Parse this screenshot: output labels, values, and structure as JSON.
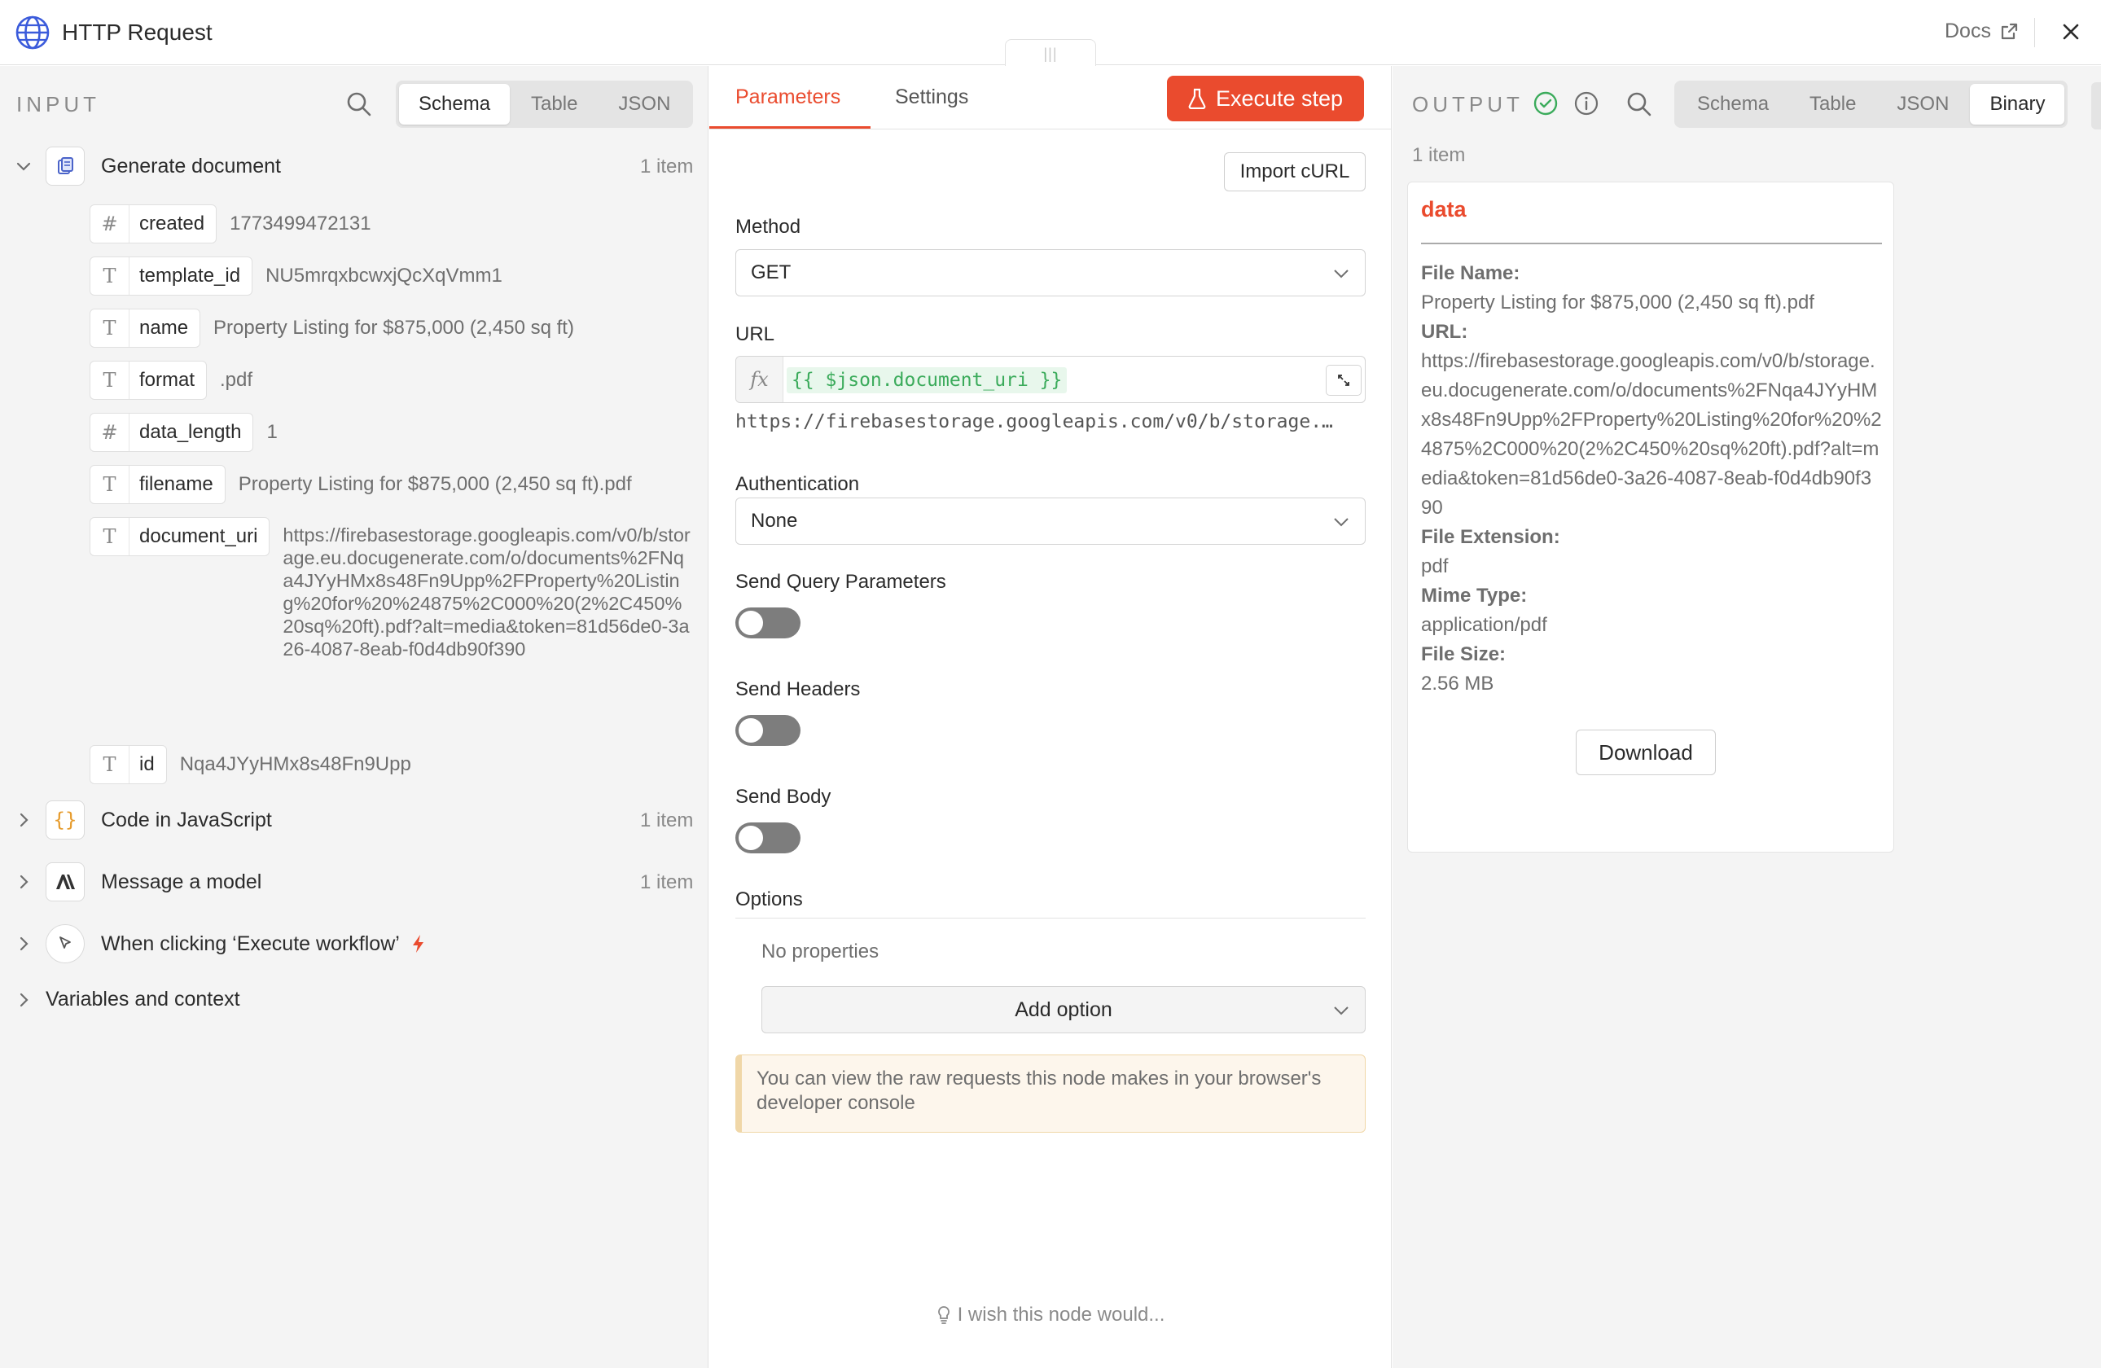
{
  "window": {
    "title": "HTTP Request",
    "docs_label": "Docs",
    "drag_handle": "|||"
  },
  "input": {
    "label": "INPUT",
    "views": [
      "Schema",
      "Table",
      "JSON"
    ],
    "active_view": "Schema",
    "nodes": [
      {
        "label": "Generate document",
        "count": "1 item",
        "icon": "document-icon",
        "expanded": true
      },
      {
        "label": "Code in JavaScript",
        "count": "1 item",
        "icon": "braces-icon",
        "expanded": false
      },
      {
        "label": "Message a model",
        "count": "1 item",
        "icon": "anthropic-icon",
        "expanded": false
      },
      {
        "label": "When clicking ‘Execute workflow’",
        "count": "",
        "icon": "cursor-icon",
        "expanded": false
      }
    ],
    "fields": [
      {
        "type": "#",
        "name": "created",
        "value": "1773499472131"
      },
      {
        "type": "T",
        "name": "template_id",
        "value": "NU5mrqxbcwxjQcXqVmm1"
      },
      {
        "type": "T",
        "name": "name",
        "value": "Property Listing for $875,000 (2,450 sq ft)"
      },
      {
        "type": "T",
        "name": "format",
        "value": ".pdf"
      },
      {
        "type": "#",
        "name": "data_length",
        "value": "1"
      },
      {
        "type": "T",
        "name": "filename",
        "value": "Property Listing for $875,000 (2,450 sq ft).pdf"
      },
      {
        "type": "T",
        "name": "document_uri",
        "value": "https://firebasestorage.googleapis.com/v0/b/storage.eu.docugenerate.com/o/documents%2FNqa4JYyHMx8s48Fn9Upp%2FProperty%20Listing%20for%20%24875%2C000%20(2%2C450%20sq%20ft).pdf?alt=media&token=81d56de0-3a26-4087-8eab-f0d4db90f390"
      },
      {
        "type": "T",
        "name": "id",
        "value": "Nqa4JYyHMx8s48Fn9Upp"
      }
    ],
    "variables_label": "Variables and context"
  },
  "params": {
    "tabs": [
      "Parameters",
      "Settings"
    ],
    "active_tab": "Parameters",
    "execute_label": "Execute step",
    "import_curl_label": "Import cURL",
    "method_label": "Method",
    "method_value": "GET",
    "url_label": "URL",
    "url_expression": "{{ $json.document_uri }}",
    "url_preview": "https://firebasestorage.googleapis.com/v0/b/storage.…",
    "auth_label": "Authentication",
    "auth_value": "None",
    "send_query_label": "Send Query Parameters",
    "send_query_on": false,
    "send_headers_label": "Send Headers",
    "send_headers_on": false,
    "send_body_label": "Send Body",
    "send_body_on": false,
    "options_label": "Options",
    "no_properties": "No properties",
    "add_option_label": "Add option",
    "notice": "You can view the raw requests this node makes in your browser's developer console",
    "wish_label": "I wish this node would..."
  },
  "output": {
    "label": "OUTPUT",
    "views": [
      "Schema",
      "Table",
      "JSON",
      "Binary"
    ],
    "active_view": "Binary",
    "item_count": "1 item",
    "card": {
      "title": "data",
      "file_name_label": "File Name:",
      "file_name": "Property Listing for $875,000 (2,450 sq ft).pdf",
      "url_label": "URL:",
      "url": "https://firebasestorage.googleapis.com/v0/b/storage.eu.docugenerate.com/o/documents%2FNqa4JYyHMx8s48Fn9Upp%2FProperty%20Listing%20for%20%24875%2C000%20(2%2C450%20sq%20ft).pdf?alt=media&token=81d56de0-3a26-4087-8eab-f0d4db90f390",
      "ext_label": "File Extension:",
      "ext": "pdf",
      "mime_label": "Mime Type:",
      "mime": "application/pdf",
      "size_label": "File Size:",
      "size": "2.56 MB",
      "download_label": "Download"
    }
  },
  "colors": {
    "accent": "#ea4b2e",
    "success": "#3bab5b",
    "toggle_off": "#7d7d7d"
  }
}
